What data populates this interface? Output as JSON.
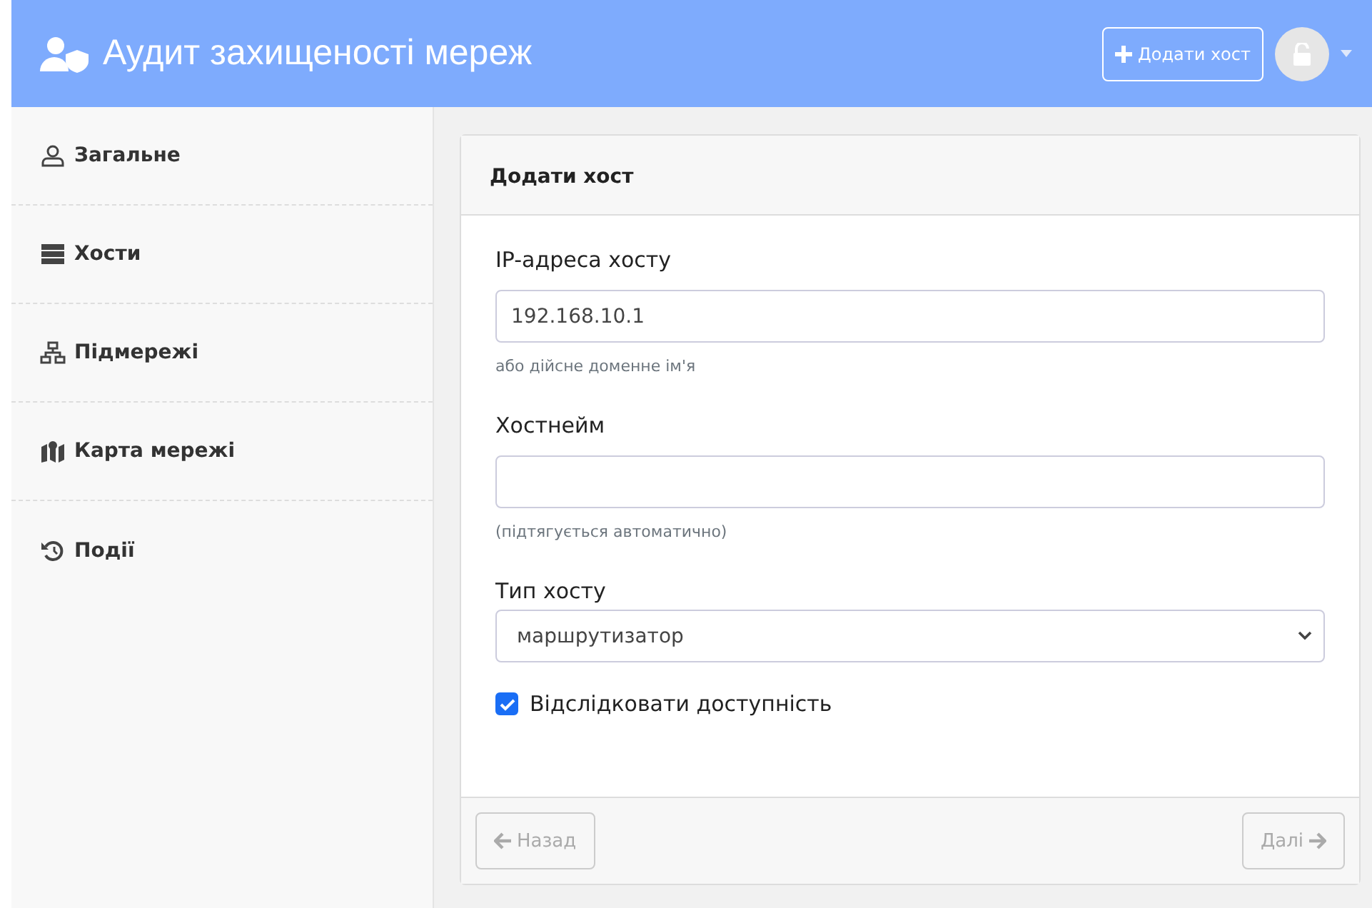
{
  "header": {
    "title": "Аудит захищеності мереж",
    "add_button": "Додати хост"
  },
  "sidebar": {
    "items": [
      {
        "label": "Загальне",
        "kind": "user",
        "selected": false
      },
      {
        "label": "Хости",
        "kind": "server",
        "selected": false
      },
      {
        "label": "Підмережі",
        "kind": "network",
        "selected": false
      },
      {
        "label": "Карта мережі",
        "kind": "map",
        "selected": false
      },
      {
        "label": "Події",
        "kind": "history",
        "selected": false
      }
    ]
  },
  "card": {
    "title": "Додати хост",
    "fields": [
      {
        "kind": "text",
        "label": "IP-адреса хосту",
        "value": "192.168.10.1",
        "help": "або дійсне доменне ім'я"
      },
      {
        "kind": "text",
        "label": "Хостнейм",
        "help": "(підтягується автоматично)"
      },
      {
        "kind": "select",
        "label": "Тип хосту",
        "value": "маршрутизатор"
      },
      {
        "kind": "checkbox",
        "label": "Відслідковати доступність",
        "checked": true
      }
    ],
    "back": {
      "label": "Назад",
      "disabled": true
    },
    "next": {
      "label": "Далі",
      "disabled": true
    }
  }
}
